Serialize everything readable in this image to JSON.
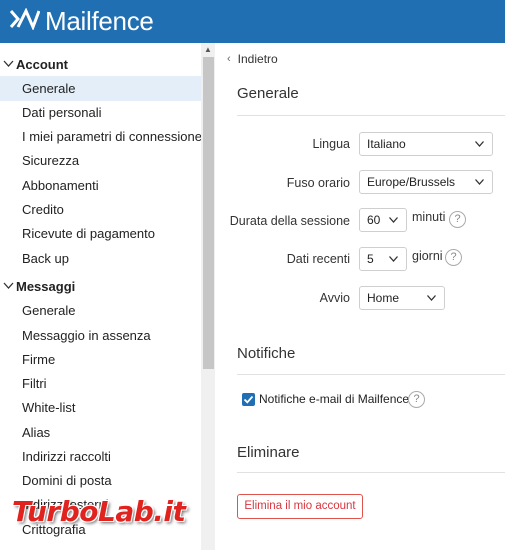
{
  "header": {
    "brand": "Mailfence",
    "brand_color": "#1f6fb2",
    "logo_icon": "mailfence-logo-icon"
  },
  "sidebar": {
    "sections": [
      {
        "title": "Account",
        "items": [
          "Generale",
          "Dati personali",
          "I miei parametri di connessione",
          "Sicurezza",
          "Abbonamenti",
          "Credito",
          "Ricevute di pagamento",
          "Back up"
        ]
      },
      {
        "title": "Messaggi",
        "items": [
          "Generale",
          "Messaggio in assenza",
          "Firme",
          "Filtri",
          "White-list",
          "Alias",
          "Indirizzi raccolti",
          "Domini di posta",
          "Indirizzi esterni",
          "Crittografia"
        ]
      }
    ],
    "active_item": "Account / Generale"
  },
  "main": {
    "back_label": "Indietro",
    "general": {
      "title": "Generale",
      "language": {
        "label": "Lingua",
        "value": "Italiano"
      },
      "timezone": {
        "label": "Fuso orario",
        "value": "Europe/Brussels"
      },
      "session": {
        "label": "Durata della sessione",
        "value": "60",
        "unit": "minuti"
      },
      "recent": {
        "label": "Dati recenti",
        "value": "5",
        "unit": "giorni"
      },
      "startup": {
        "label": "Avvio",
        "value": "Home"
      }
    },
    "notifications": {
      "title": "Notifiche",
      "email_label": "Notifiche e-mail di Mailfence",
      "email_checked": true
    },
    "delete": {
      "title": "Eliminare",
      "button_label": "Elimina il mio account",
      "button_color": "#d9363e"
    }
  },
  "watermark": {
    "text": "TurboLab.it"
  }
}
